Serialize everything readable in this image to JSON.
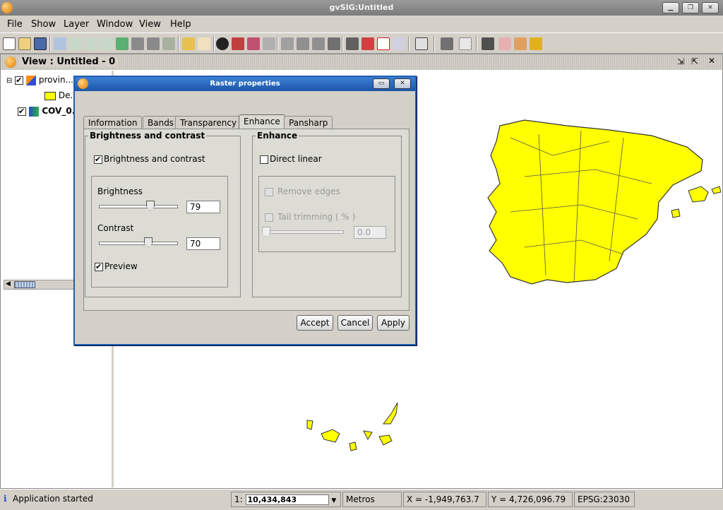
{
  "window": {
    "title": "gvSIG:Untitled"
  },
  "menu": [
    "File",
    "Show",
    "Layer",
    "Window",
    "View",
    "Help"
  ],
  "view": {
    "title": "View : Untitled - 0"
  },
  "toc": {
    "layers": [
      {
        "name": "provin...",
        "checked": true
      },
      {
        "legend_label": "De..."
      },
      {
        "name": "COV_0...",
        "checked": true
      }
    ]
  },
  "dialog": {
    "title": "Raster properties",
    "tabs": [
      "Information",
      "Bands",
      "Transparency",
      "Enhance",
      "Pansharp"
    ],
    "active_tab": "Enhance",
    "brightness_contrast": {
      "legend": "Brightness and contrast",
      "checkbox_label": "Brightness and contrast",
      "checked": true,
      "brightness_label": "Brightness",
      "brightness_value": "79",
      "contrast_label": "Contrast",
      "contrast_value": "70",
      "preview_label": "Preview",
      "preview_checked": true
    },
    "enhance": {
      "legend": "Enhance",
      "direct_linear_label": "Direct linear",
      "direct_linear_checked": false,
      "remove_edges_label": "Remove edges",
      "tail_trimming_label": "Tail trimming ( % )",
      "tail_value": "0.0"
    },
    "buttons": {
      "accept": "Accept",
      "cancel": "Cancel",
      "apply": "Apply"
    }
  },
  "status": {
    "message": "Application started",
    "scale_prefix": "1:",
    "scale": "10,434,843",
    "units": "Metros",
    "x": "X = -1,949,763.7",
    "y": "Y = 4,726,096.79",
    "epsg": "EPSG:23030"
  }
}
